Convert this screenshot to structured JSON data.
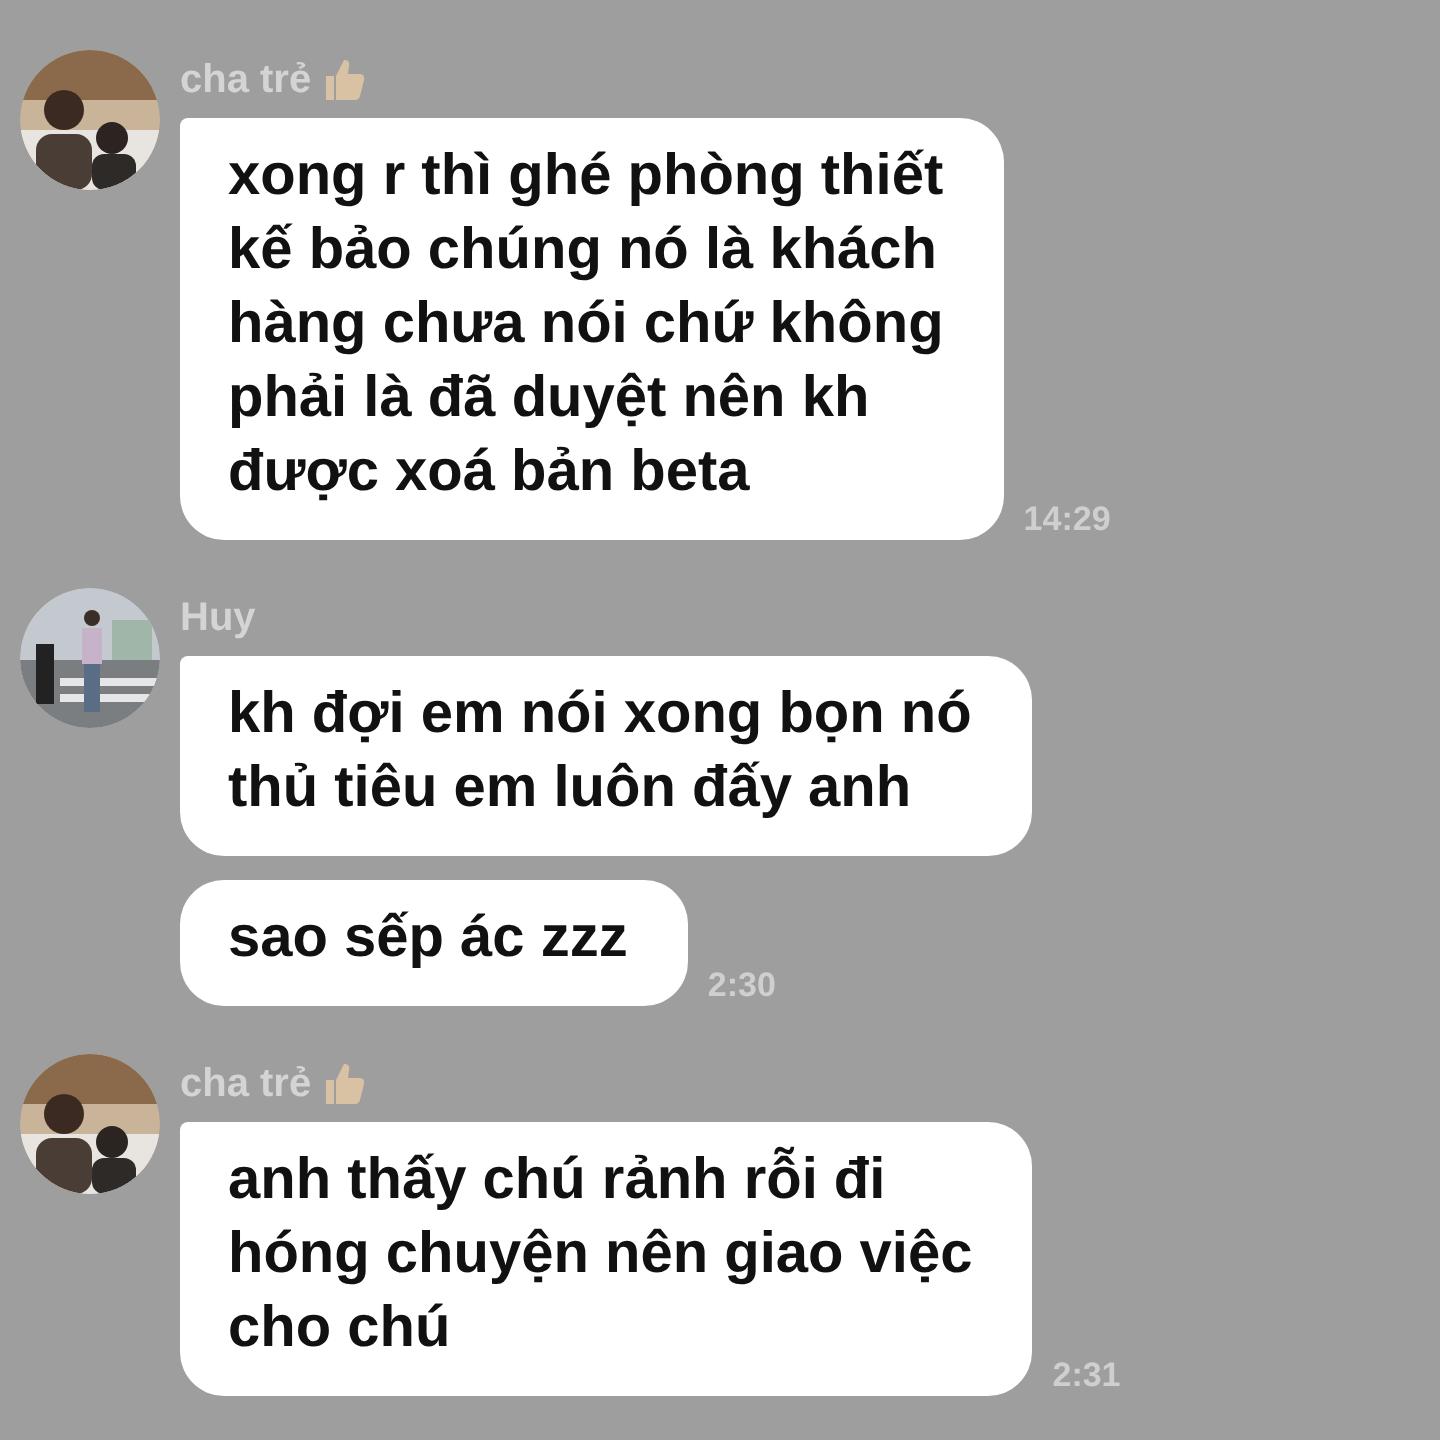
{
  "messages": [
    {
      "sender": "cha trẻ",
      "thumbs_up": true,
      "bubbles": [
        {
          "lines": [
            "xong r thì ghé phòng thiết",
            "kế bảo chúng nó là khách",
            "hàng chưa nói chứ không",
            "phải là đã duyệt nên kh",
            "được xoá bản beta"
          ],
          "time": "14:29"
        }
      ]
    },
    {
      "sender": "Huy",
      "thumbs_up": false,
      "bubbles": [
        {
          "lines": [
            "kh đợi em nói xong bọn nó",
            "thủ tiêu em luôn đấy anh"
          ]
        },
        {
          "lines": [
            "sao sếp ác zzz"
          ],
          "time": "2:30"
        }
      ]
    },
    {
      "sender": "cha trẻ",
      "thumbs_up": true,
      "bubbles": [
        {
          "lines": [
            "anh thấy chú rảnh rỗi đi",
            "hóng chuyện nên giao việc",
            "cho chú"
          ],
          "time": "2:31"
        }
      ]
    }
  ]
}
